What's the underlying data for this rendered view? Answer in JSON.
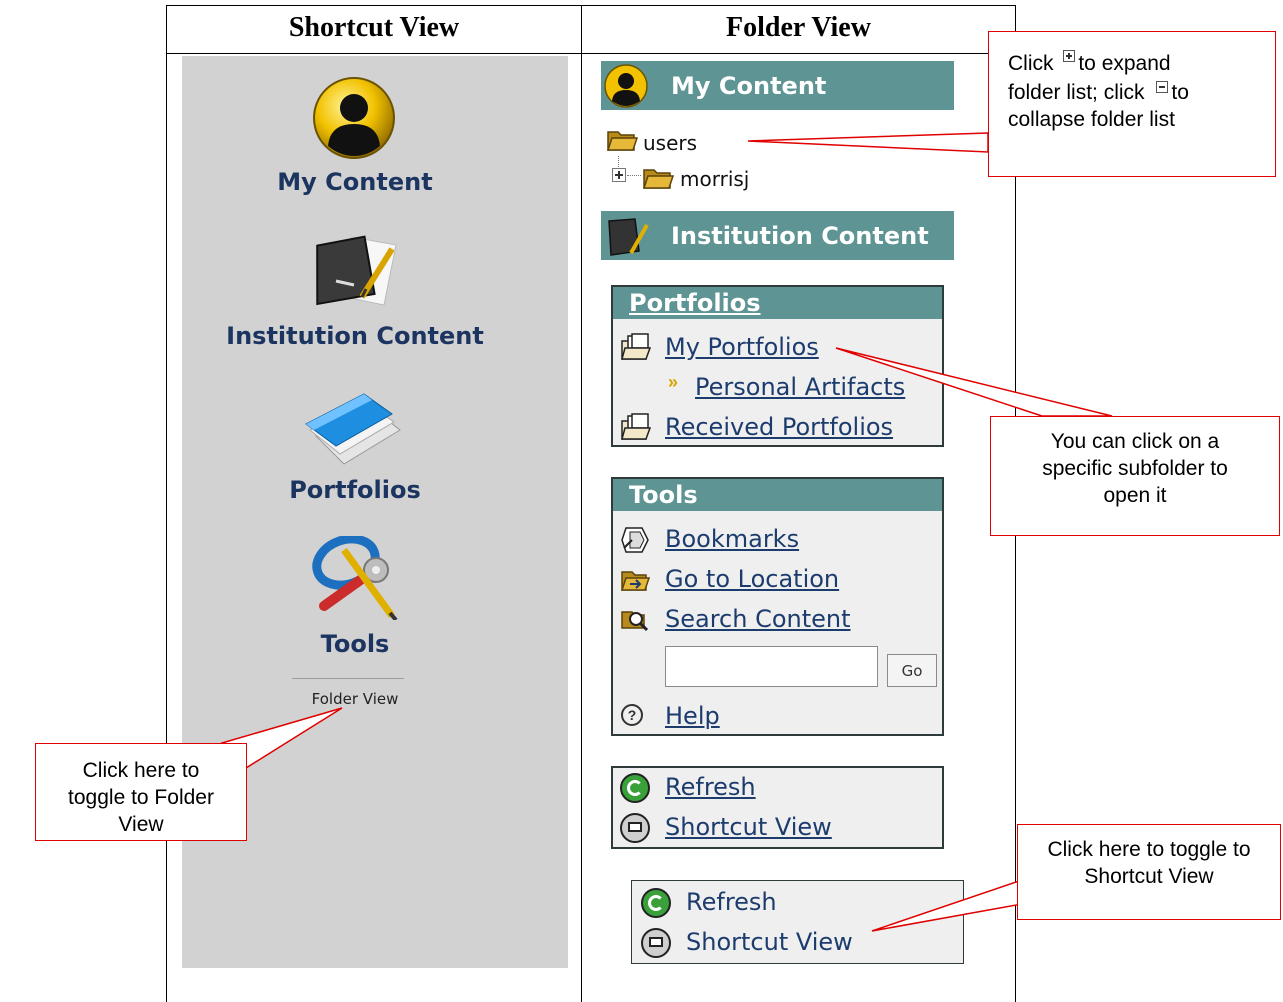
{
  "columns": {
    "left_title": "Shortcut View",
    "right_title": "Folder View"
  },
  "shortcut_view": {
    "items": [
      {
        "label": "My Content",
        "icon": "person-avatar-icon"
      },
      {
        "label": "Institution Content",
        "icon": "chalkboard-icon"
      },
      {
        "label": "Portfolios",
        "icon": "blue-folder-icon"
      },
      {
        "label": "Tools",
        "icon": "tools-icon"
      }
    ],
    "folder_view_link": "Folder View"
  },
  "folder_view": {
    "my_content_header": "My Content",
    "tree": {
      "root": "users",
      "child": "morrisj"
    },
    "institution_header": "Institution Content",
    "portfolios": {
      "title": "Portfolios",
      "my_portfolios": "My Portfolios",
      "personal_artifacts": "Personal Artifacts",
      "received_portfolios": "Received Portfolios"
    },
    "tools": {
      "title": "Tools",
      "bookmarks": "Bookmarks",
      "go_to_location": "Go to Location",
      "search_content": "Search Content",
      "search_value": "",
      "go_button": "Go",
      "help": "Help"
    },
    "bottom_box": {
      "refresh": "Refresh",
      "shortcut_view": "Shortcut View"
    },
    "zoom_box": {
      "refresh": "Refresh",
      "shortcut_view": "Shortcut View"
    }
  },
  "callouts": {
    "expand": {
      "click": "Click",
      "to_expand": "to expand",
      "folder_list_click": "folder list; click",
      "to": "to",
      "collapse": "collapse folder list"
    },
    "subfolder": "You can click on a specific subfolder to open it",
    "toggle_folder": "Click here to toggle to Folder View",
    "toggle_shortcut": "Click here to toggle to Shortcut View"
  },
  "colors": {
    "teal": "#5e9494",
    "link_blue": "#1d3c6e",
    "panel_gray": "#d2d2d2",
    "callout_red": "#e00000"
  }
}
